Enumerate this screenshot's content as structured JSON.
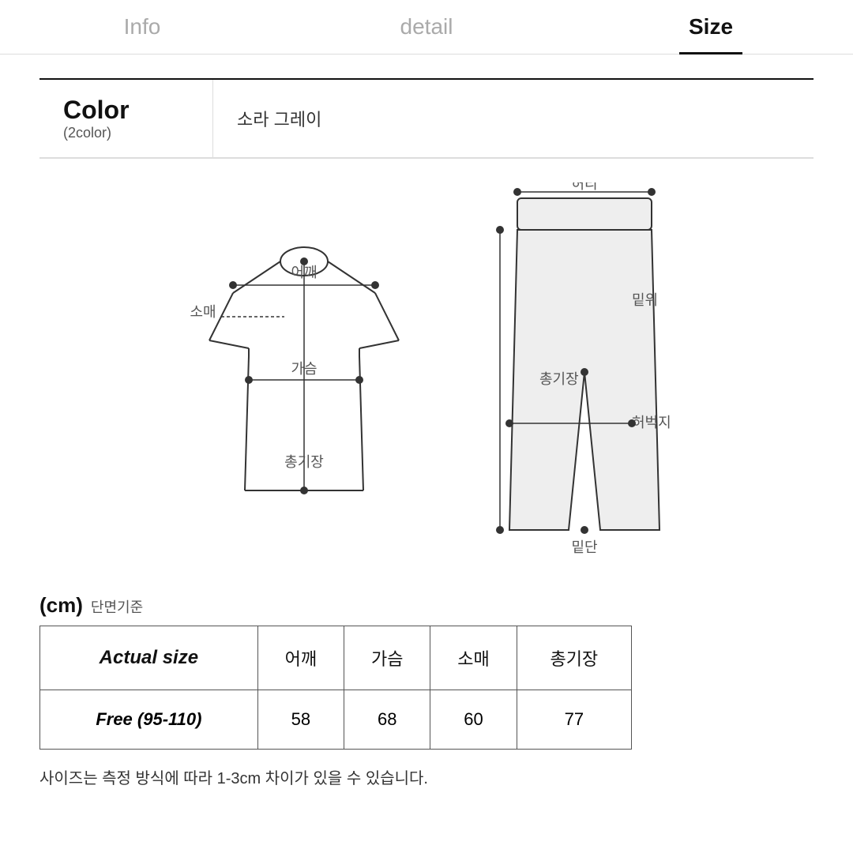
{
  "tabs": [
    {
      "label": "Info",
      "active": false
    },
    {
      "label": "detail",
      "active": false
    },
    {
      "label": "Size",
      "active": true
    }
  ],
  "color_section": {
    "main_label": "Color",
    "sub_label": "(2color)",
    "value": "소라  그레이"
  },
  "cm_label": "(cm)",
  "danmyeon": "단면기준",
  "table": {
    "headers": [
      "Actual size",
      "어깨",
      "가슴",
      "소매",
      "총기장"
    ],
    "rows": [
      [
        "Free (95-110)",
        "58",
        "68",
        "60",
        "77"
      ]
    ]
  },
  "size_note": "사이즈는 측정 방식에 따라 1-3cm 차이가 있을 수 있습니다.",
  "shirt_labels": {
    "shoulder": "어깨",
    "chest": "가슴",
    "sleeve": "소매",
    "total_length": "총기장"
  },
  "pants_labels": {
    "waist": "허리",
    "rise": "밑위",
    "thigh": "허벅지",
    "total_length": "총기장",
    "hem": "밑단"
  }
}
